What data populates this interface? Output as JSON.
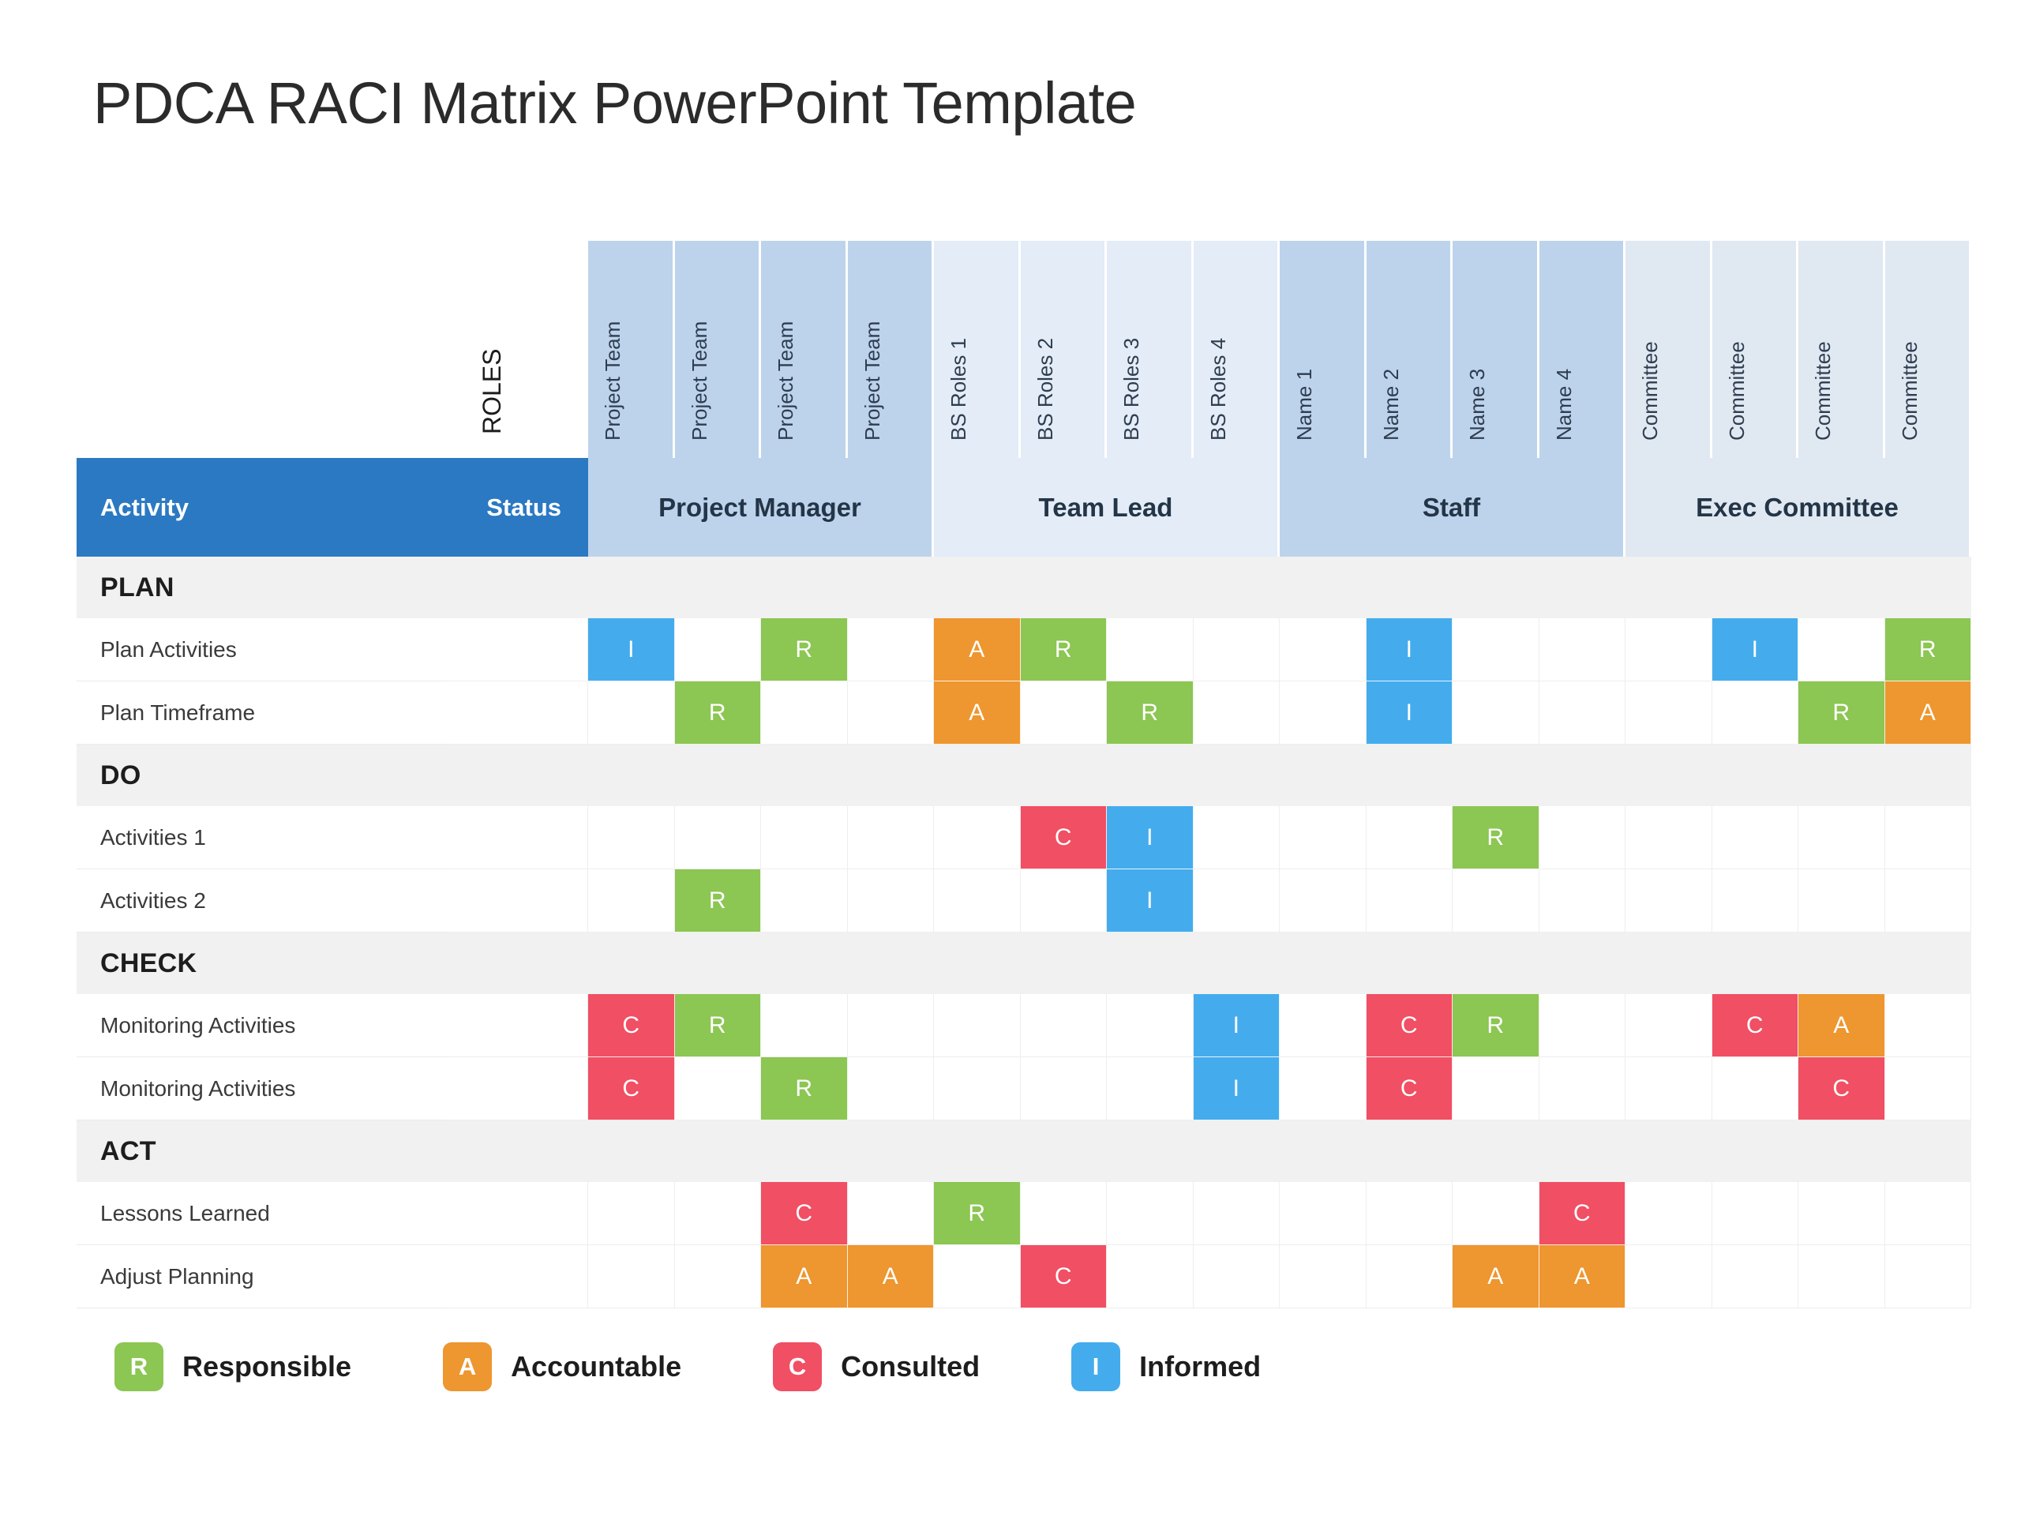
{
  "title": "PDCA RACI Matrix PowerPoint Template",
  "roles_axis_label": "ROLES",
  "header": {
    "activity_label": "Activity",
    "status_label": "Status"
  },
  "groups": [
    {
      "label": "Project Manager",
      "key": "pm",
      "span": 4
    },
    {
      "label": "Team Lead",
      "key": "tl",
      "span": 4
    },
    {
      "label": "Staff",
      "key": "st",
      "span": 4
    },
    {
      "label": "Exec Committee",
      "key": "ex",
      "span": 4
    }
  ],
  "columns": [
    {
      "label": "Project Team",
      "group": "pm"
    },
    {
      "label": "Project Team",
      "group": "pm"
    },
    {
      "label": "Project Team",
      "group": "pm"
    },
    {
      "label": "Project Team",
      "group": "pm"
    },
    {
      "label": "BS Roles 1",
      "group": "tl"
    },
    {
      "label": "BS Roles 2",
      "group": "tl"
    },
    {
      "label": "BS Roles 3",
      "group": "tl"
    },
    {
      "label": "BS Roles 4",
      "group": "tl"
    },
    {
      "label": "Name 1",
      "group": "st"
    },
    {
      "label": "Name 2",
      "group": "st"
    },
    {
      "label": "Name 3",
      "group": "st"
    },
    {
      "label": "Name 4",
      "group": "st"
    },
    {
      "label": "Committee",
      "group": "ex"
    },
    {
      "label": "Committee",
      "group": "ex"
    },
    {
      "label": "Committee",
      "group": "ex"
    },
    {
      "label": "Committee",
      "group": "ex"
    }
  ],
  "sections": [
    {
      "label": "PLAN",
      "rows": [
        {
          "activity": "Plan Activities",
          "status": "",
          "cells": [
            "I",
            "",
            "R",
            "",
            "A",
            "R",
            "",
            "",
            "",
            "I",
            "",
            "",
            "",
            "I",
            "",
            "R"
          ]
        },
        {
          "activity": "Plan Timeframe",
          "status": "",
          "cells": [
            "",
            "R",
            "",
            "",
            "A",
            "",
            "R",
            "",
            "",
            "I",
            "",
            "",
            "",
            "",
            "R",
            "A"
          ]
        }
      ]
    },
    {
      "label": "DO",
      "rows": [
        {
          "activity": "Activities 1",
          "status": "",
          "cells": [
            "",
            "",
            "",
            "",
            "",
            "C",
            "I",
            "",
            "",
            "",
            "R",
            "",
            "",
            "",
            "",
            ""
          ]
        },
        {
          "activity": "Activities 2",
          "status": "",
          "cells": [
            "",
            "R",
            "",
            "",
            "",
            "",
            "I",
            "",
            "",
            "",
            "",
            "",
            "",
            "",
            "",
            ""
          ]
        }
      ]
    },
    {
      "label": "CHECK",
      "rows": [
        {
          "activity": "Monitoring  Activities",
          "status": "",
          "cells": [
            "C",
            "R",
            "",
            "",
            "",
            "",
            "",
            "I",
            "",
            "C",
            "R",
            "",
            "",
            "C",
            "A",
            ""
          ]
        },
        {
          "activity": "Monitoring  Activities",
          "status": "",
          "cells": [
            "C",
            "",
            "R",
            "",
            "",
            "",
            "",
            "I",
            "",
            "C",
            "",
            "",
            "",
            "",
            "C",
            ""
          ]
        }
      ]
    },
    {
      "label": "ACT",
      "rows": [
        {
          "activity": "Lessons Learned",
          "status": "",
          "cells": [
            "",
            "",
            "C",
            "",
            "R",
            "",
            "",
            "",
            "",
            "",
            "",
            "C",
            "",
            "",
            "",
            ""
          ]
        },
        {
          "activity": "Adjust Planning",
          "status": "",
          "cells": [
            "",
            "",
            "A",
            "A",
            "",
            "C",
            "",
            "",
            "",
            "",
            "A",
            "A",
            "",
            "",
            "",
            ""
          ]
        }
      ]
    }
  ],
  "legend": [
    {
      "code": "R",
      "label": "Responsible",
      "color": "#8cc653"
    },
    {
      "code": "A",
      "label": "Accountable",
      "color": "#ee962f"
    },
    {
      "code": "C",
      "label": "Consulted",
      "color": "#f04f64"
    },
    {
      "code": "I",
      "label": "Informed",
      "color": "#44aced"
    }
  ],
  "colors": {
    "header_bar": "#2b79c2",
    "group_dark": "#bdd3ec",
    "group_light": "#e3ecf7",
    "band": "#f1f1f1",
    "responsible": "#8cc653",
    "accountable": "#ee962f",
    "consulted": "#f04f64",
    "informed": "#44aced"
  }
}
